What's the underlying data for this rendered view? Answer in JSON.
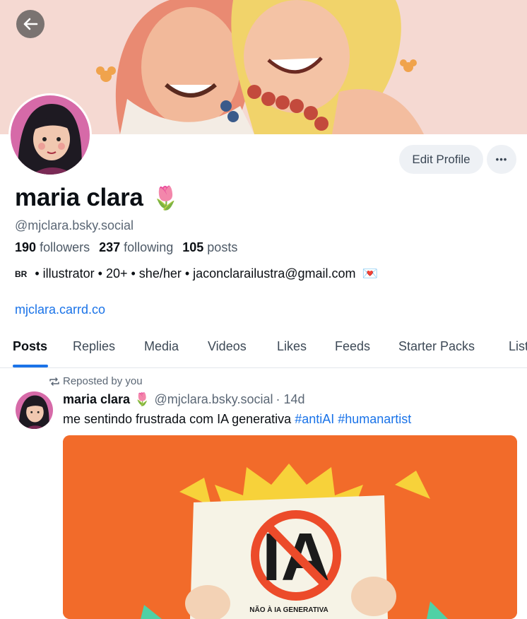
{
  "profile": {
    "display_name": "maria clara",
    "name_emoji": "🌷",
    "handle": "@mjclara.bsky.social",
    "followers_count": "190",
    "followers_label": "followers",
    "following_count": "237",
    "following_label": "following",
    "posts_count": "105",
    "posts_label": "posts",
    "bio_flag": "BR",
    "bio_text": " • illustrator • 20+ • she/her • jaconclarailustra@gmail.com ",
    "bio_emoji": "💌",
    "link": "mjclara.carrd.co"
  },
  "actions": {
    "edit_label": "Edit Profile",
    "more_label": "•••"
  },
  "tabs": [
    "Posts",
    "Replies",
    "Media",
    "Videos",
    "Likes",
    "Feeds",
    "Starter Packs",
    "Lists"
  ],
  "feed": {
    "repost_label": "Reposted by you",
    "post": {
      "author": "maria clara",
      "author_emoji": "🌷",
      "handle": "@mjclara.bsky.social",
      "time": "· 14d",
      "text": "me sentindo frustrada com IA generativa ",
      "tags": [
        "#antiAI",
        "#humanartist"
      ],
      "image_sign_text": "NÃO À IA GENERATIVA",
      "image_sign_letters": "IA"
    }
  },
  "colors": {
    "accent": "#1a73e8",
    "button_bg": "#eef1f5",
    "image_bg": "#f26b2a"
  }
}
